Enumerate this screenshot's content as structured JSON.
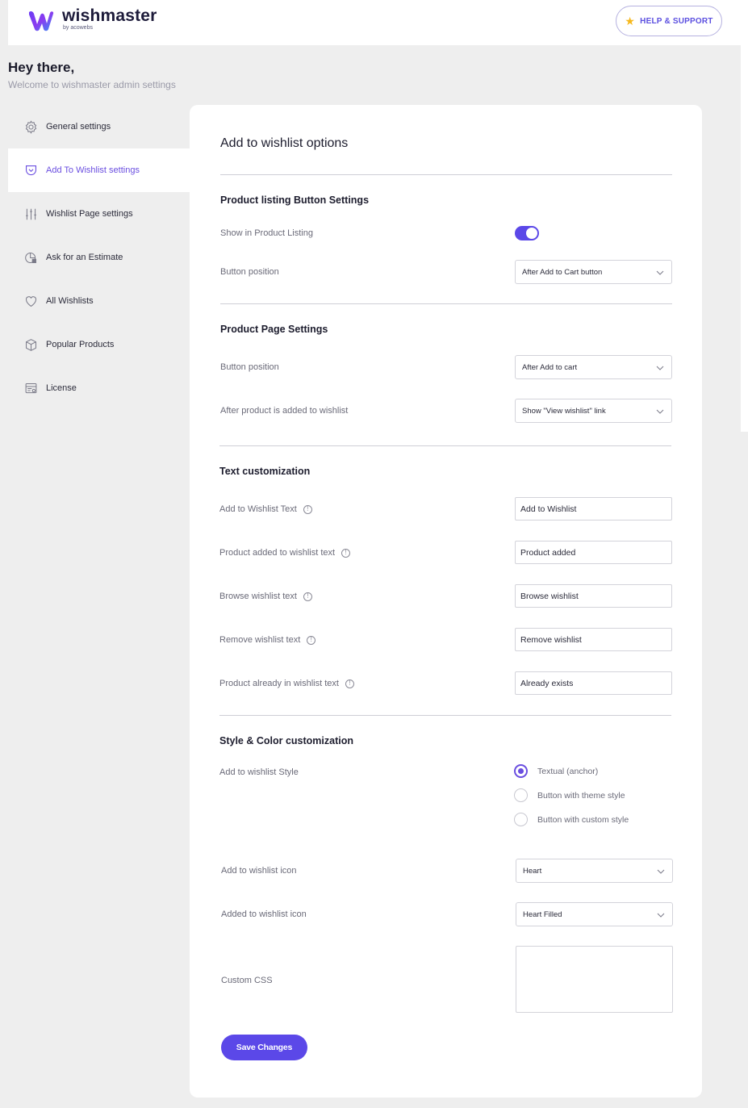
{
  "header": {
    "logo_name": "wishmaster",
    "logo_sub": "by acowebs",
    "help_label": "HELP & SUPPORT"
  },
  "greeting": {
    "title": "Hey there,",
    "subtitle": "Welcome to wishmaster admin settings"
  },
  "sidebar": {
    "items": [
      {
        "label": "General settings",
        "icon": "gear-icon"
      },
      {
        "label": "Add To Wishlist settings",
        "icon": "pocket-icon"
      },
      {
        "label": "Wishlist Page settings",
        "icon": "sliders-icon"
      },
      {
        "label": "Ask for an Estimate",
        "icon": "estimate-icon"
      },
      {
        "label": "All Wishlists",
        "icon": "heart-icon"
      },
      {
        "label": "Popular Products",
        "icon": "box-icon"
      },
      {
        "label": "License",
        "icon": "license-icon"
      }
    ],
    "active_index": 1
  },
  "main": {
    "title": "Add to wishlist options",
    "listing": {
      "heading": "Product listing Button Settings",
      "show_label": "Show in Product Listing",
      "show_enabled": true,
      "position_label": "Button position",
      "position_value": "After Add to Cart button"
    },
    "product_page": {
      "heading": "Product Page Settings",
      "position_label": "Button position",
      "position_value": "After Add to cart",
      "after_label": "After product is added to wishlist",
      "after_value": "Show \"View wishlist\" link"
    },
    "text": {
      "heading": "Text customization",
      "fields": [
        {
          "label": "Add to Wishlist Text",
          "value": "Add to Wishlist"
        },
        {
          "label": "Product added to wishlist text",
          "value": "Product added"
        },
        {
          "label": "Browse wishlist text",
          "value": "Browse wishlist"
        },
        {
          "label": "Remove wishlist text",
          "value": "Remove wishlist"
        },
        {
          "label": "Product already in wishlist text",
          "value": "Already exists"
        }
      ]
    },
    "style": {
      "heading": "Style & Color customization",
      "style_label": "Add to wishlist Style",
      "options": [
        "Textual (anchor)",
        "Button with theme style",
        "Button with custom style"
      ],
      "selected_index": 0,
      "icon_label": "Add to wishlist icon",
      "icon_value": "Heart",
      "added_icon_label": "Added to wishlist icon",
      "added_icon_value": "Heart Filled",
      "css_label": "Custom CSS",
      "css_value": ""
    },
    "save_label": "Save Changes"
  },
  "colors": {
    "accent": "#5b48e8",
    "active_nav": "#6a4ee0",
    "star": "#f6b81c"
  }
}
